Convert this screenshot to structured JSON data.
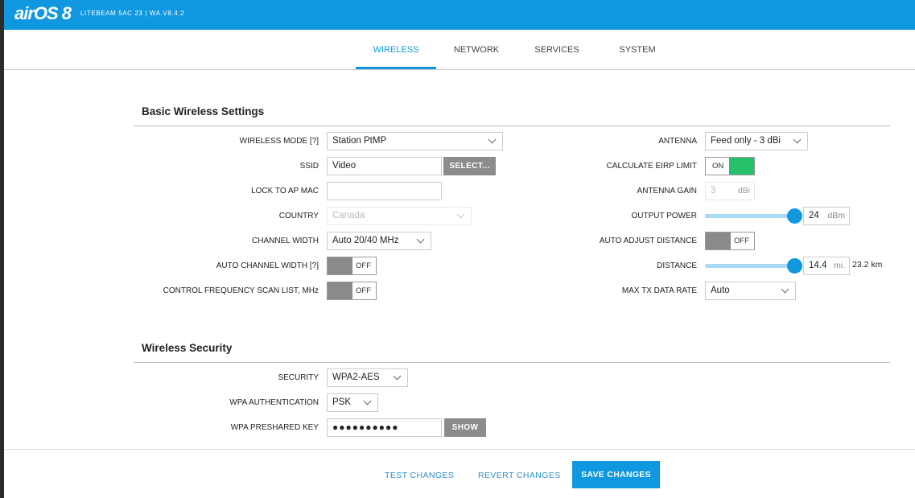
{
  "header": {
    "logo": "airOS 8",
    "device": "LITEBEAM 5AC 23 | WA.V8.4.2"
  },
  "tabs": [
    "WIRELESS",
    "NETWORK",
    "SERVICES",
    "SYSTEM"
  ],
  "basic": {
    "title": "Basic Wireless Settings",
    "wireless_mode": {
      "label": "WIRELESS MODE [?]",
      "value": "Station PtMP"
    },
    "ssid": {
      "label": "SSID",
      "value": "Video",
      "select_label": "SELECT..."
    },
    "lock_ap_mac": {
      "label": "LOCK TO AP MAC",
      "value": ""
    },
    "country": {
      "label": "COUNTRY",
      "value": "Canada"
    },
    "channel_width": {
      "label": "CHANNEL WIDTH",
      "value": "Auto 20/40 MHz"
    },
    "auto_channel_width": {
      "label": "AUTO CHANNEL WIDTH [?]",
      "state": "OFF"
    },
    "control_freq": {
      "label": "CONTROL FREQUENCY SCAN LIST, MHz",
      "state": "OFF"
    },
    "antenna": {
      "label": "ANTENNA",
      "value": "Feed only - 3 dBi"
    },
    "calc_eirp": {
      "label": "CALCULATE EIRP LIMIT",
      "state": "ON"
    },
    "antenna_gain": {
      "label": "ANTENNA GAIN",
      "value": "3",
      "unit": "dBi"
    },
    "output_power": {
      "label": "OUTPUT POWER",
      "value": "24",
      "unit": "dBm"
    },
    "auto_adjust_distance": {
      "label": "AUTO ADJUST DISTANCE",
      "state": "OFF"
    },
    "distance": {
      "label": "DISTANCE",
      "value": "14.4",
      "unit": "mi.",
      "km": "23.2 km"
    },
    "max_tx_rate": {
      "label": "MAX TX DATA RATE",
      "value": "Auto"
    }
  },
  "security": {
    "title": "Wireless Security",
    "security": {
      "label": "SECURITY",
      "value": "WPA2-AES"
    },
    "wpa_auth": {
      "label": "WPA AUTHENTICATION",
      "value": "PSK"
    },
    "wpa_key": {
      "label": "WPA PRESHARED KEY",
      "value": "●●●●●●●●●●",
      "show_label": "SHOW"
    }
  },
  "footer": {
    "test": "TEST CHANGES",
    "revert": "REVERT CHANGES",
    "save": "SAVE CHANGES"
  },
  "colors": {
    "accent": "#0f98e0",
    "toggle_on": "#26c06a",
    "toggle_off": "#8a8a8a"
  }
}
